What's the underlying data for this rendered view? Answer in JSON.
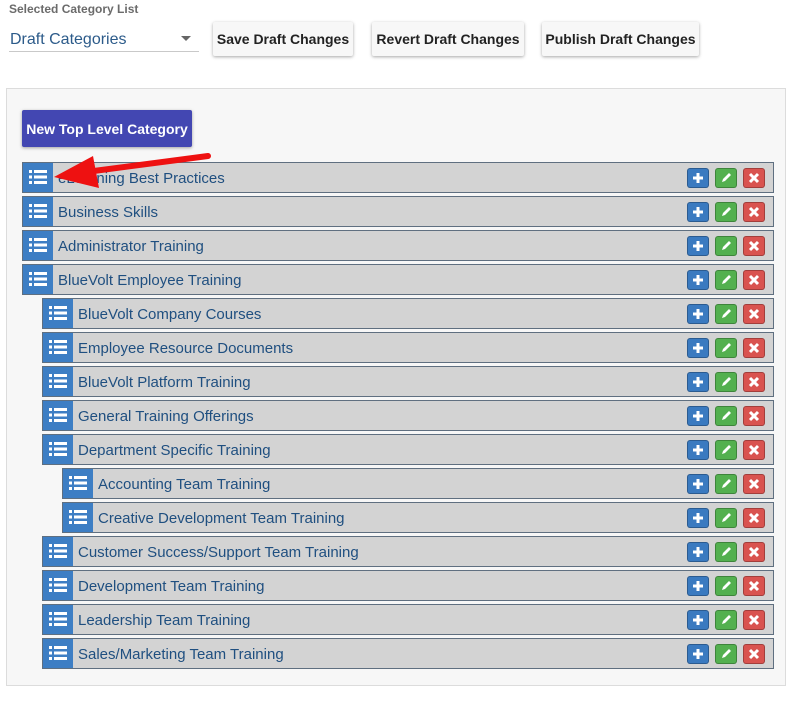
{
  "selector": {
    "label": "Selected Category List",
    "value": "Draft Categories"
  },
  "toolbar": {
    "save_label": "Save Draft Changes",
    "revert_label": "Revert Draft Changes",
    "publish_label": "Publish Draft Changes"
  },
  "panel": {
    "new_top_label": "New Top Level Category"
  },
  "categories": [
    {
      "name": "eLearning Best Practices",
      "depth": 0
    },
    {
      "name": "Business Skills",
      "depth": 0
    },
    {
      "name": "Administrator Training",
      "depth": 0
    },
    {
      "name": "BlueVolt Employee Training",
      "depth": 0
    },
    {
      "name": "BlueVolt Company Courses",
      "depth": 1
    },
    {
      "name": "Employee Resource Documents",
      "depth": 1
    },
    {
      "name": "BlueVolt Platform Training",
      "depth": 1
    },
    {
      "name": "General Training Offerings",
      "depth": 1
    },
    {
      "name": "Department Specific Training",
      "depth": 1
    },
    {
      "name": "Accounting Team Training",
      "depth": 2
    },
    {
      "name": "Creative Development Team Training",
      "depth": 2
    },
    {
      "name": "Customer Success/Support Team Training",
      "depth": 1
    },
    {
      "name": "Development Team Training",
      "depth": 1
    },
    {
      "name": "Leadership Team Training",
      "depth": 1
    },
    {
      "name": "Sales/Marketing Team Training",
      "depth": 1
    }
  ],
  "icons": {
    "handle": "list-icon",
    "add": "plus-icon",
    "edit": "pencil-icon",
    "delete": "x-icon"
  },
  "colors": {
    "primary": "#4347b2",
    "handle": "#3d7ec4",
    "add": "#3a7ac0",
    "edit": "#53b04f",
    "delete": "#d9534f",
    "annotation_arrow": "#ee1111"
  }
}
